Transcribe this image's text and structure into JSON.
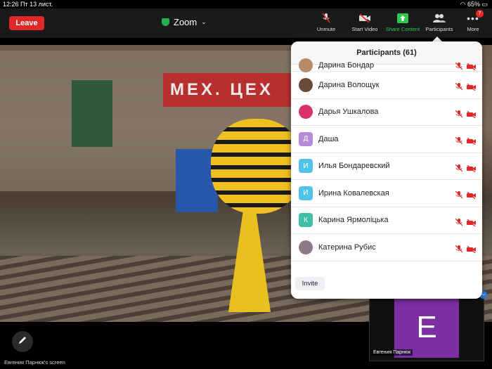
{
  "status": {
    "time": "12:26",
    "date": "Пт 13 лист.",
    "battery": "65%"
  },
  "topbar": {
    "leave_label": "Leave",
    "meeting_title": "Zoom",
    "tools": [
      {
        "label": "Unmute",
        "icon": "mic-muted-icon"
      },
      {
        "label": "Start Video",
        "icon": "video-off-icon"
      },
      {
        "label": "Share Content",
        "icon": "share-icon"
      },
      {
        "label": "Participants",
        "icon": "people-icon"
      },
      {
        "label": "More",
        "icon": "more-icon",
        "badge": "7"
      }
    ]
  },
  "video": {
    "sign_text": "МЕХ. ЦЕХ"
  },
  "panel": {
    "title": "Participants (61)",
    "invite_label": "Invite",
    "participants": [
      {
        "name": "Дарина Бондар",
        "avatar": "photo",
        "color": "#b88a66"
      },
      {
        "name": "Дарина Волощук",
        "avatar": "photo",
        "color": "#6a4a3a"
      },
      {
        "name": "Дарья Ушкалова",
        "avatar": "photo",
        "color": "#d8336b"
      },
      {
        "name": "Даша",
        "avatar": "Д",
        "color": "#b68ad6"
      },
      {
        "name": "Илья Бондаревский",
        "avatar": "И",
        "color": "#4fc3e8"
      },
      {
        "name": "Ирина Ковалевская",
        "avatar": "И",
        "color": "#4fc3e8"
      },
      {
        "name": "Карина Ярмоліцька",
        "avatar": "К",
        "color": "#3fbfa8"
      },
      {
        "name": "Катерина Рубис",
        "avatar": "photo",
        "color": "#8a7a8a"
      }
    ]
  },
  "thumbnail": {
    "initial": "E",
    "name": "Евгения Парнюк"
  },
  "screen_label": "Евгения Парнюк's screen",
  "colors": {
    "leave": "#e02828",
    "share": "#2ec84e",
    "muted": "#e02828",
    "avatar_tile": "#7b2fa3"
  }
}
